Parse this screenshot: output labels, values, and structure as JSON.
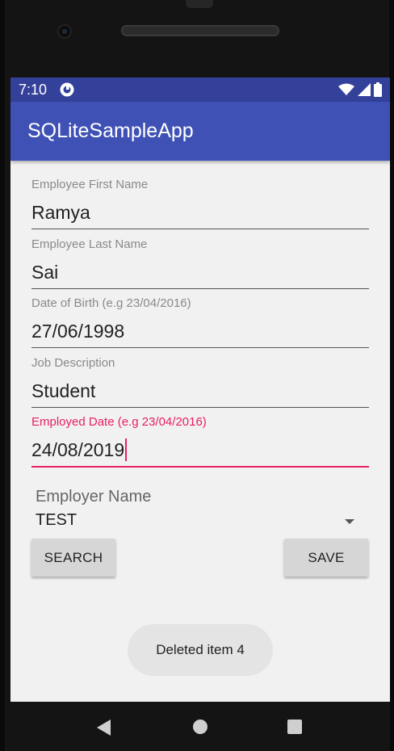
{
  "status_bar": {
    "time": "7:10",
    "icons": [
      "app-notification-icon",
      "wifi-icon",
      "signal-icon",
      "battery-icon"
    ]
  },
  "app_bar": {
    "title": "SQLiteSampleApp",
    "color": "#3f51b5",
    "status_color": "#33419a"
  },
  "form": {
    "first_name": {
      "label": "Employee First Name",
      "value": "Ramya"
    },
    "last_name": {
      "label": "Employee Last Name",
      "value": "Sai"
    },
    "dob": {
      "label": "Date of Birth (e.g 23/04/2016)",
      "value": "27/06/1998"
    },
    "job_description": {
      "label": "Job Description",
      "value": "Student"
    },
    "employed_date": {
      "label": "Employed Date (e.g 23/04/2016)",
      "value": "24/08/2019",
      "focused": true
    }
  },
  "employer": {
    "label": "Employer Name",
    "selected": "TEST"
  },
  "buttons": {
    "search": "SEARCH",
    "save": "SAVE"
  },
  "toast": {
    "message": "Deleted item 4"
  },
  "accent_color": "#e91e63",
  "nav": [
    "back-icon",
    "home-icon",
    "recents-icon"
  ]
}
